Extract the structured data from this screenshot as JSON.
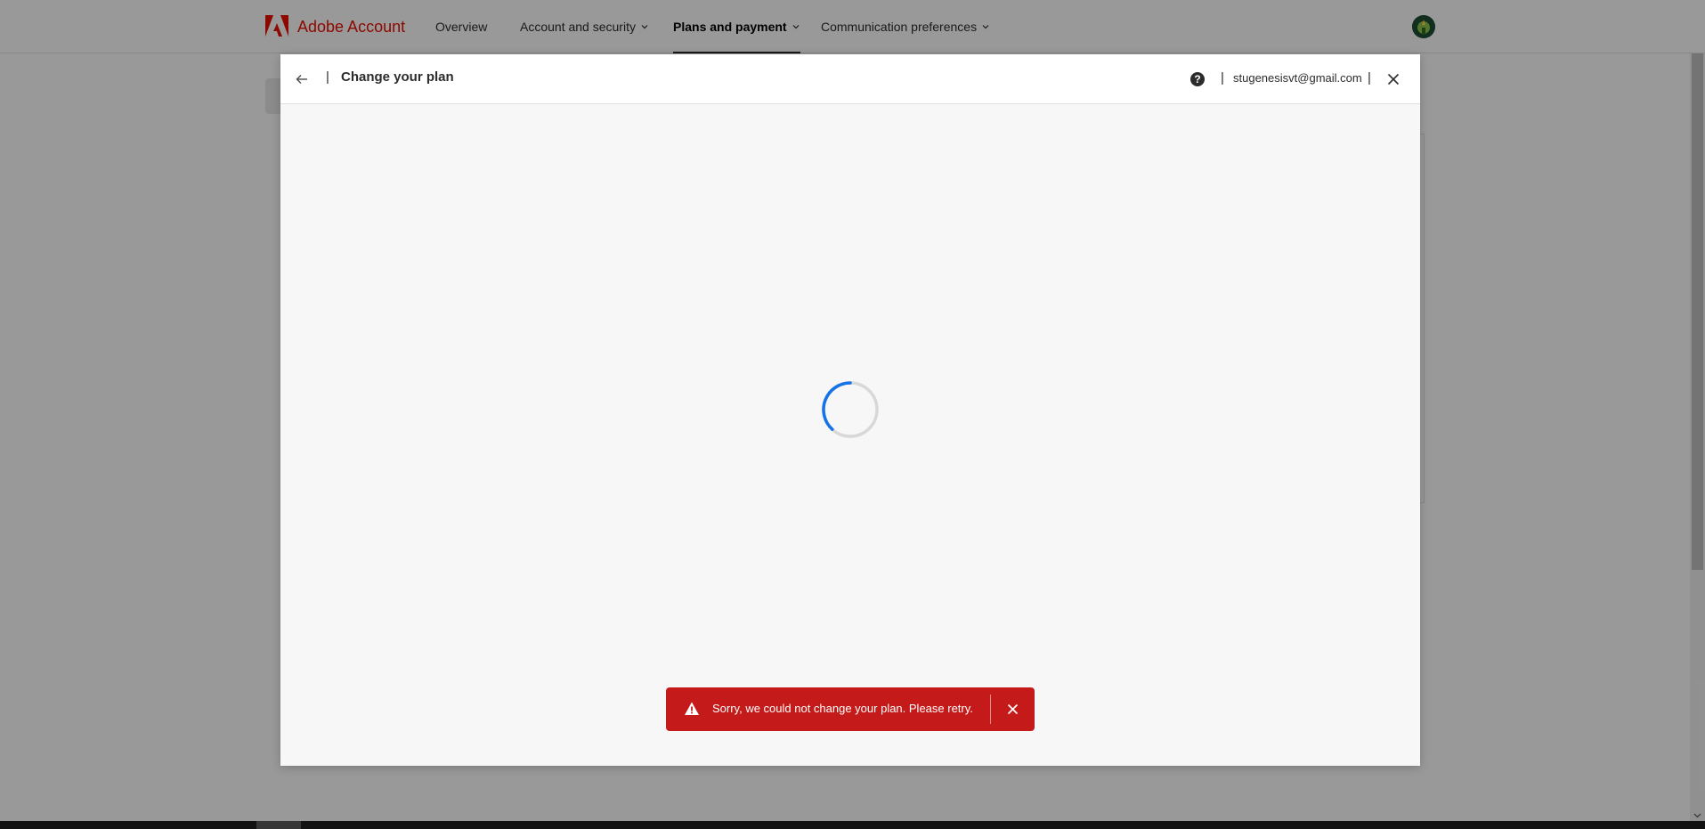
{
  "app": {
    "brand_name": "Adobe Account",
    "brand_color": "#eb1000"
  },
  "nav": {
    "items": [
      {
        "label": "Overview",
        "has_dropdown": false,
        "active": false
      },
      {
        "label": "Account and security",
        "has_dropdown": true,
        "active": false
      },
      {
        "label": "Plans and payment",
        "has_dropdown": true,
        "active": true
      },
      {
        "label": "Communication preferences",
        "has_dropdown": true,
        "active": false
      }
    ],
    "avatar_icon": "avatar-icon"
  },
  "modal": {
    "title": "Change your plan",
    "back_icon": "arrow-left-icon",
    "help_icon": "question-circle-icon",
    "user_email": "stugenesisvt@gmail.com",
    "close_icon": "close-icon",
    "separator": "|",
    "loading": true,
    "spinner_color": "#1473e6"
  },
  "toast": {
    "message": "Sorry, we could not change your plan. Please retry.",
    "icon": "alert-triangle-icon",
    "close_icon": "close-icon",
    "background_color": "#c41a1a",
    "text_color": "#ffffff"
  }
}
